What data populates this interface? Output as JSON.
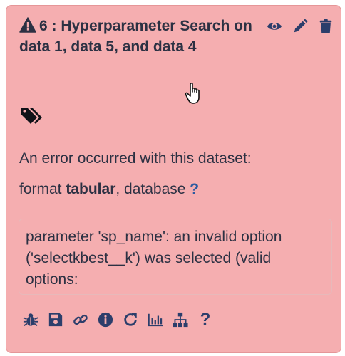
{
  "dataset": {
    "title": "6 : Hyperparameter Search on data 1, data 5, and data 4",
    "error_heading": "An error occurred with this dataset:",
    "format_prefix": "format ",
    "format_value": "tabular",
    "database_prefix": ",  database ",
    "database_value": "?",
    "error_message": "parameter 'sp_name': an invalid option ('selectkbest__k') was selected (valid options:"
  },
  "icons": {
    "warning": "warning-icon",
    "header_actions": [
      "eye-icon",
      "pencil-icon",
      "trash-icon"
    ],
    "tags": "tags-icon",
    "toolbar": [
      "bug-icon",
      "save-icon",
      "link-icon",
      "info-icon",
      "rerun-icon",
      "chart-icon",
      "sitemap-icon",
      "question-icon"
    ]
  },
  "toolbar": {
    "help_label": "?"
  },
  "colors": {
    "card_background": "#f5aeb0",
    "text": "#2c3143",
    "icon": "#2c3e6b",
    "link": "#2c5aa0"
  }
}
